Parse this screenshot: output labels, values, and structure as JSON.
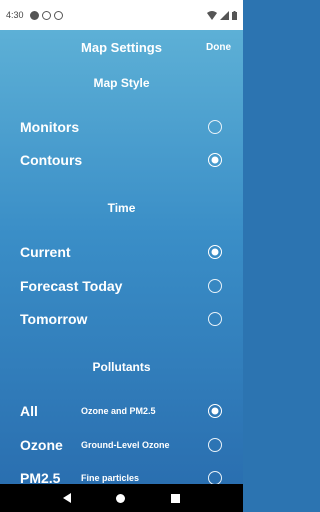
{
  "status": {
    "time": "4:30"
  },
  "header": {
    "title": "Map Settings",
    "done_label": "Done"
  },
  "map_style": {
    "title": "Map Style",
    "options": [
      {
        "label": "Monitors",
        "selected": false
      },
      {
        "label": "Contours",
        "selected": true
      }
    ]
  },
  "time": {
    "title": "Time",
    "options": [
      {
        "label": "Current",
        "selected": true
      },
      {
        "label": "Forecast Today",
        "selected": false
      },
      {
        "label": "Tomorrow",
        "selected": false
      }
    ]
  },
  "pollutants": {
    "title": "Pollutants",
    "options": [
      {
        "label": "All",
        "description": "Ozone and PM2.5",
        "selected": true
      },
      {
        "label": "Ozone",
        "description": "Ground-Level Ozone",
        "selected": false
      },
      {
        "label": "PM2.5",
        "description": "Fine particles",
        "selected": false
      }
    ]
  },
  "colors": {
    "gradient_top": "#5db0d6",
    "gradient_bottom": "#2a6fb0",
    "text": "#ffffff"
  }
}
